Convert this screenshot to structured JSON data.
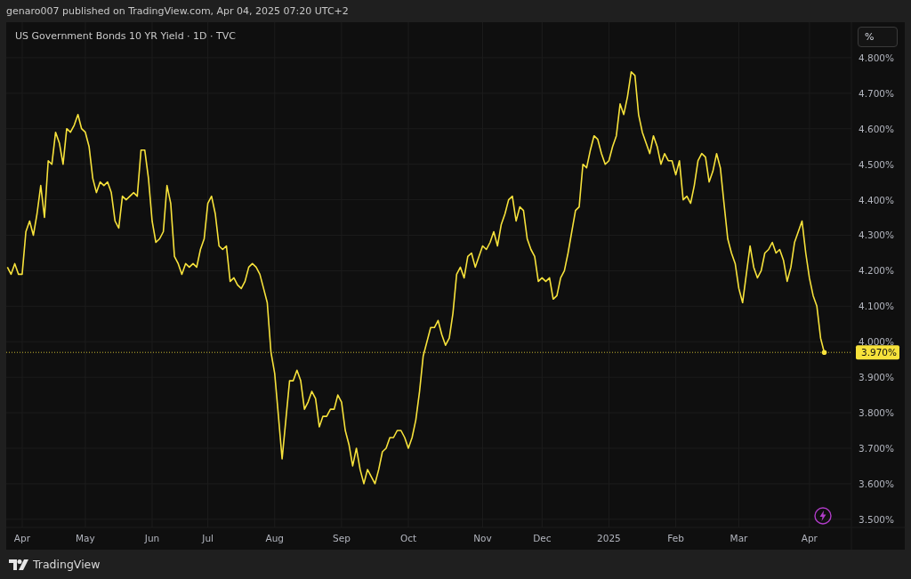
{
  "header": {
    "text": "genaro007 published on TradingView.com, Apr 04, 2025 07:20 UTC+2"
  },
  "chart": {
    "scale_toggle": "%",
    "chart_data": {
      "type": "line",
      "title": "US Government Bonds 10 YR Yield · 1D · TVC",
      "grid": true,
      "ylim": [
        3.477,
        4.9
      ],
      "series": [
        {
          "color": "#f7e23b",
          "values": [
            4.21,
            4.19,
            4.22,
            4.19,
            4.19,
            4.31,
            4.34,
            4.3,
            4.36,
            4.44,
            4.35,
            4.51,
            4.5,
            4.59,
            4.56,
            4.5,
            4.6,
            4.59,
            4.61,
            4.64,
            4.6,
            4.59,
            4.55,
            4.46,
            4.42,
            4.45,
            4.44,
            4.45,
            4.42,
            4.34,
            4.32,
            4.41,
            4.4,
            4.41,
            4.42,
            4.41,
            4.54,
            4.54,
            4.46,
            4.34,
            4.28,
            4.29,
            4.31,
            4.44,
            4.39,
            4.24,
            4.22,
            4.19,
            4.22,
            4.21,
            4.22,
            4.21,
            4.26,
            4.29,
            4.39,
            4.41,
            4.36,
            4.27,
            4.26,
            4.27,
            4.17,
            4.18,
            4.16,
            4.15,
            4.17,
            4.21,
            4.22,
            4.21,
            4.19,
            4.15,
            4.11,
            3.97,
            3.91,
            3.79,
            3.67,
            3.78,
            3.89,
            3.89,
            3.92,
            3.89,
            3.81,
            3.83,
            3.86,
            3.84,
            3.76,
            3.79,
            3.79,
            3.81,
            3.81,
            3.85,
            3.83,
            3.75,
            3.71,
            3.65,
            3.7,
            3.64,
            3.6,
            3.64,
            3.62,
            3.6,
            3.64,
            3.69,
            3.7,
            3.73,
            3.73,
            3.75,
            3.75,
            3.73,
            3.7,
            3.73,
            3.78,
            3.86,
            3.96,
            4.0,
            4.04,
            4.04,
            4.06,
            4.02,
            3.99,
            4.01,
            4.08,
            4.19,
            4.21,
            4.18,
            4.24,
            4.25,
            4.21,
            4.24,
            4.27,
            4.26,
            4.28,
            4.31,
            4.27,
            4.33,
            4.36,
            4.4,
            4.41,
            4.34,
            4.38,
            4.37,
            4.29,
            4.26,
            4.24,
            4.17,
            4.18,
            4.17,
            4.18,
            4.12,
            4.13,
            4.18,
            4.2,
            4.25,
            4.31,
            4.37,
            4.38,
            4.5,
            4.49,
            4.54,
            4.58,
            4.57,
            4.53,
            4.5,
            4.51,
            4.55,
            4.58,
            4.67,
            4.64,
            4.69,
            4.76,
            4.75,
            4.64,
            4.59,
            4.56,
            4.53,
            4.58,
            4.55,
            4.5,
            4.53,
            4.51,
            4.51,
            4.47,
            4.51,
            4.4,
            4.41,
            4.39,
            4.44,
            4.51,
            4.53,
            4.52,
            4.45,
            4.48,
            4.53,
            4.49,
            4.39,
            4.29,
            4.25,
            4.22,
            4.15,
            4.11,
            4.19,
            4.27,
            4.21,
            4.18,
            4.2,
            4.25,
            4.26,
            4.28,
            4.25,
            4.26,
            4.23,
            4.17,
            4.21,
            4.28,
            4.31,
            4.34,
            4.25,
            4.18,
            4.13,
            4.1,
            4.01,
            3.97
          ]
        }
      ],
      "categories": [
        null,
        null,
        null,
        null,
        "Apr",
        null,
        null,
        null,
        null,
        null,
        null,
        null,
        null,
        null,
        null,
        null,
        null,
        null,
        null,
        null,
        null,
        "May",
        null,
        null,
        null,
        null,
        null,
        null,
        null,
        null,
        null,
        null,
        null,
        null,
        null,
        null,
        null,
        null,
        null,
        "Jun",
        null,
        null,
        null,
        null,
        null,
        null,
        null,
        null,
        null,
        null,
        null,
        null,
        null,
        null,
        "Jul",
        null,
        null,
        null,
        null,
        null,
        null,
        null,
        null,
        null,
        null,
        null,
        null,
        null,
        null,
        null,
        null,
        null,
        "Aug",
        null,
        null,
        null,
        null,
        null,
        null,
        null,
        null,
        null,
        null,
        null,
        null,
        null,
        null,
        null,
        null,
        null,
        "Sep",
        null,
        null,
        null,
        null,
        null,
        null,
        null,
        null,
        null,
        null,
        null,
        null,
        null,
        null,
        null,
        null,
        null,
        "Oct",
        null,
        null,
        null,
        null,
        null,
        null,
        null,
        null,
        null,
        null,
        null,
        null,
        null,
        null,
        null,
        null,
        null,
        null,
        null,
        "Nov",
        null,
        null,
        null,
        null,
        null,
        null,
        null,
        null,
        null,
        null,
        null,
        null,
        null,
        null,
        null,
        "Dec",
        null,
        null,
        null,
        null,
        null,
        null,
        null,
        null,
        null,
        null,
        null,
        null,
        null,
        null,
        null,
        null,
        null,
        "2025",
        null,
        null,
        null,
        null,
        null,
        null,
        null,
        null,
        null,
        null,
        null,
        null,
        null,
        null,
        null,
        null,
        null,
        "Feb",
        null,
        null,
        null,
        null,
        null,
        null,
        null,
        null,
        null,
        null,
        null,
        null,
        null,
        null,
        null,
        null,
        "Mar",
        null,
        null,
        null,
        null,
        null,
        null,
        null,
        null,
        null,
        null,
        null,
        null,
        null,
        null,
        null,
        null,
        null,
        null,
        "Apr",
        null,
        null,
        null,
        null
      ],
      "yticks": [
        {
          "value": 3.5,
          "label": "3.500%"
        },
        {
          "value": 3.6,
          "label": "3.600%"
        },
        {
          "value": 3.7,
          "label": "3.700%"
        },
        {
          "value": 3.8,
          "label": "3.800%"
        },
        {
          "value": 3.9,
          "label": "3.900%"
        },
        {
          "value": 4.0,
          "label": "4.000%"
        },
        {
          "value": 4.1,
          "label": "4.100%"
        },
        {
          "value": 4.2,
          "label": "4.200%"
        },
        {
          "value": 4.3,
          "label": "4.300%"
        },
        {
          "value": 4.4,
          "label": "4.400%"
        },
        {
          "value": 4.5,
          "label": "4.500%"
        },
        {
          "value": 4.6,
          "label": "4.600%"
        },
        {
          "value": 4.7,
          "label": "4.700%"
        },
        {
          "value": 4.8,
          "label": "4.800%"
        }
      ],
      "ref_lines": [
        {
          "axis": "y",
          "value": 3.97,
          "label": "3.970%"
        }
      ]
    }
  },
  "footer": {
    "brand": "TradingView"
  }
}
